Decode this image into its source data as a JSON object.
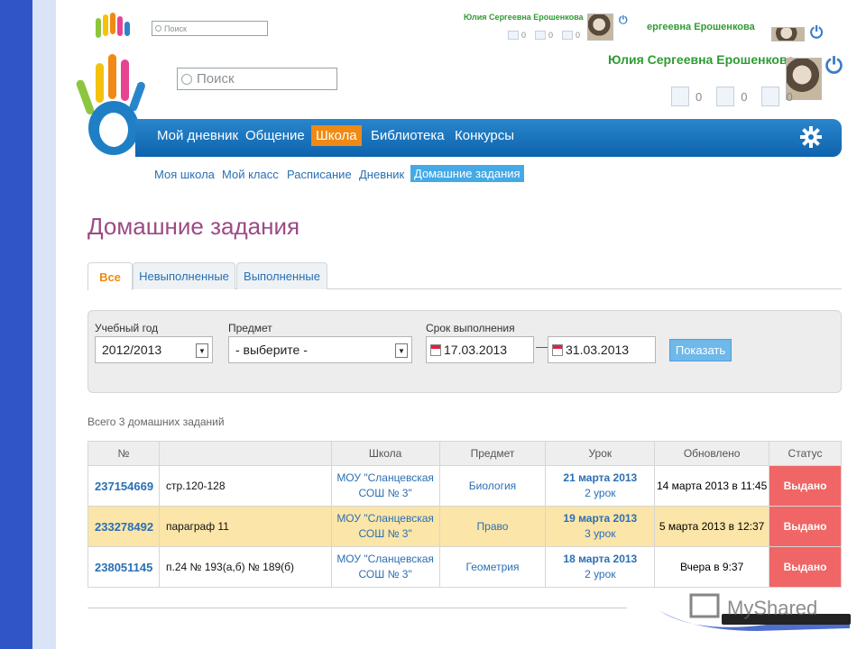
{
  "header_small": {
    "search_placeholder": "Поиск",
    "username": "Юлия Сергеевна Ерошенкова",
    "counts": [
      "0",
      "0",
      "0"
    ]
  },
  "header_partial": {
    "username_cut": "ергеевна Ерошенкова"
  },
  "header": {
    "search_placeholder": "Поиск",
    "username": "Юлия Сергеевна Ерошенкова",
    "counts": [
      "0",
      "0",
      "0"
    ]
  },
  "nav": {
    "items": [
      {
        "label": "Мой дневник"
      },
      {
        "label": "Общение"
      },
      {
        "label": "Школа"
      },
      {
        "label": "Библиотека"
      },
      {
        "label": "Конкурсы"
      }
    ],
    "active": "Школа"
  },
  "subnav": {
    "items": [
      {
        "label": "Моя школа"
      },
      {
        "label": "Мой класс"
      },
      {
        "label": "Расписание"
      },
      {
        "label": "Дневник"
      },
      {
        "label": "Домашние задания"
      }
    ],
    "active": "Домашние задания"
  },
  "page_title": "Домашние задания",
  "tabs": [
    {
      "label": "Все"
    },
    {
      "label": "Невыполненные"
    },
    {
      "label": "Выполненные"
    }
  ],
  "filter": {
    "year_label": "Учебный год",
    "year_value": "2012/2013",
    "subject_label": "Предмет",
    "subject_value": "- выберите -",
    "due_label": "Срок выполнения",
    "date_from": "17.03.2013",
    "date_sep": "—",
    "date_to": "31.03.2013",
    "show_button": "Показать"
  },
  "total_text": "Всего 3 домашних заданий",
  "table": {
    "headers": [
      "№",
      "",
      "Школа",
      "Предмет",
      "Урок",
      "Обновлено",
      "Статус"
    ],
    "rows": [
      {
        "id": "237154669",
        "desc": "стр.120-128",
        "school1": "МОУ \"Сланцевская",
        "school2": "СОШ № 3\"",
        "subject": "Биология",
        "lesson_date": "21 марта 2013",
        "lesson_num": "2 урок",
        "updated": "14 марта 2013 в 11:45",
        "status": "Выдано"
      },
      {
        "id": "233278492",
        "desc": "параграф 11",
        "school1": "МОУ \"Сланцевская",
        "school2": "СОШ № 3\"",
        "subject": "Право",
        "lesson_date": "19 марта 2013",
        "lesson_num": "3 урок",
        "updated": "5 марта 2013 в 12:37",
        "status": "Выдано"
      },
      {
        "id": "238051145",
        "desc": "п.24 № 193(а,б) № 189(б)",
        "school1": "МОУ \"Сланцевская",
        "school2": "СОШ № 3\"",
        "subject": "Геометрия",
        "lesson_date": "18 марта 2013",
        "lesson_num": "2 урок",
        "updated": "Вчера в 9:37",
        "status": "Выдано"
      }
    ]
  },
  "watermark": "MyShared",
  "colors": {
    "nav": "#0d63ad",
    "active": "#f08a14",
    "status": "#f06565",
    "title": "#9b4a86",
    "username": "#2f9b34"
  }
}
